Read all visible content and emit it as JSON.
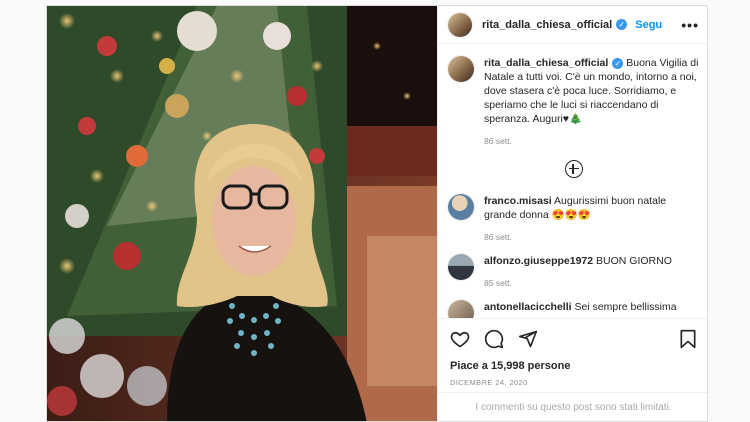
{
  "post": {
    "username": "rita_dalla_chiesa_official",
    "follow_label": "Segui",
    "more_label": "•••",
    "caption": {
      "username": "rita_dalla_chiesa_official",
      "text": "Buona Vigilia di Natale a tutti voi. C'è un mondo, intorno a noi, dove stasera c'è poca luce. Sorridiamo, e speriamo che le luci si riaccendano di speranza. Auguri♥🎄",
      "time": "86 sett."
    },
    "comments": [
      {
        "username": "franco.misasi",
        "text": "Augurissimi buon natale grande donna 😍😍😍",
        "time": "86 sett."
      },
      {
        "username": "alfonzo.giuseppe1972",
        "text": "BUON GIORNO",
        "time": "85 sett."
      },
      {
        "username": "antonellacicchelli",
        "text": "Sei sempre bellissima",
        "time": ""
      }
    ],
    "likes": "Piace a 15,998 persone",
    "date": "DICEMBRE 24, 2020",
    "limited_notice": "I commenti su questo post sono stati limitati."
  },
  "icons": {
    "verified": "verified-badge-icon",
    "like": "heart-icon",
    "comment": "comment-bubble-icon",
    "share": "paper-plane-icon",
    "save": "bookmark-icon",
    "load_more": "plus-circle-icon"
  },
  "colors": {
    "link_blue": "#0095f6",
    "verified_blue": "#3897f0",
    "muted_gray": "#8e8e8e",
    "border": "#dbdbdb"
  }
}
